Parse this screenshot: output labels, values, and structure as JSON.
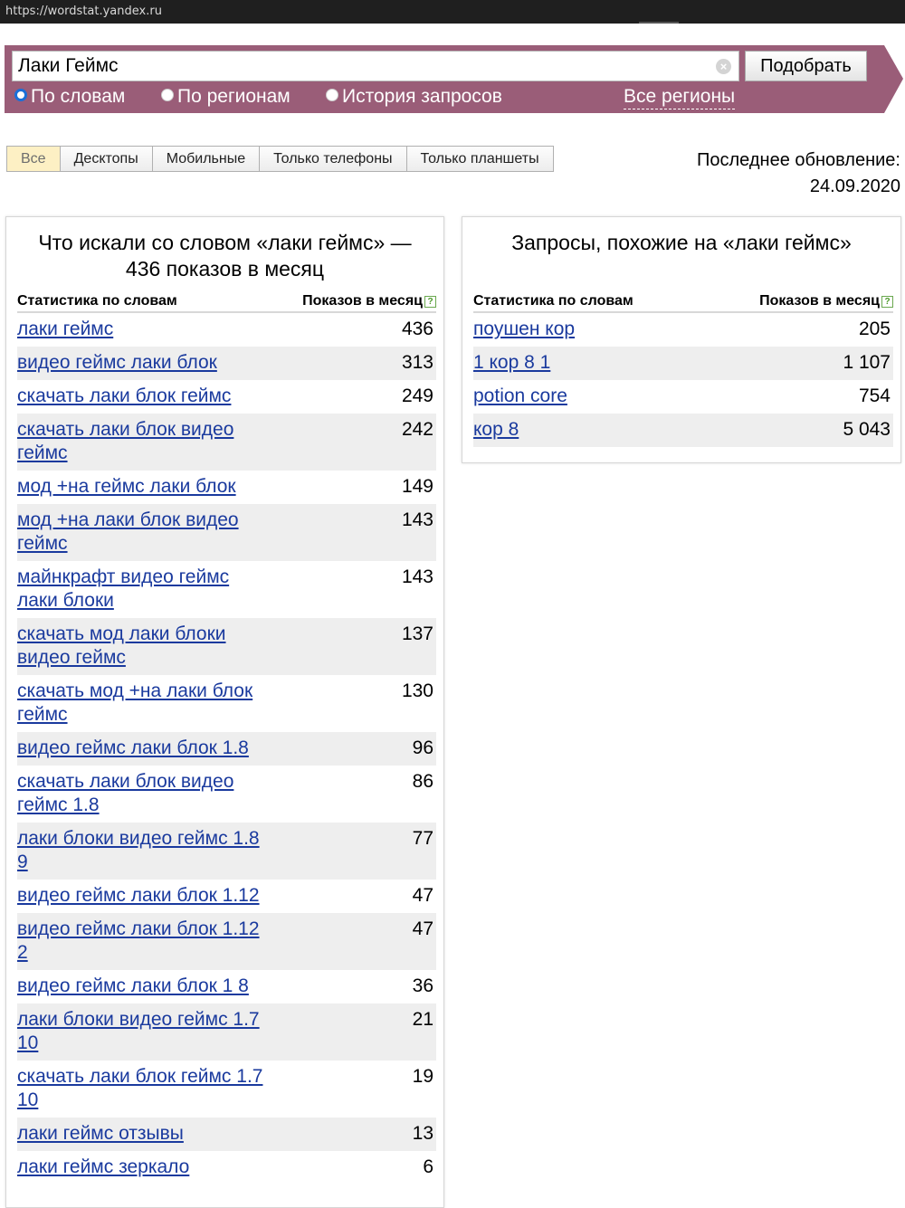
{
  "browser": {
    "url": "https://wordstat.yandex.ru"
  },
  "search": {
    "query": "Лаки Геймс",
    "submit_label": "Подобрать",
    "clear_glyph": "×",
    "modes": [
      {
        "label": "По словам",
        "selected": true
      },
      {
        "label": "По регионам",
        "selected": false
      },
      {
        "label": "История запросов",
        "selected": false
      }
    ],
    "regions_label": "Все регионы",
    "panel_color": "#9a5d78"
  },
  "tabs": [
    {
      "label": "Все",
      "active": true
    },
    {
      "label": "Десктопы",
      "active": false
    },
    {
      "label": "Мобильные",
      "active": false
    },
    {
      "label": "Только телефоны",
      "active": false
    },
    {
      "label": "Только планшеты",
      "active": false
    }
  ],
  "updated": {
    "label": "Последнее обновление:",
    "date": "24.09.2020"
  },
  "left": {
    "title": "Что искали со словом «лаки геймс» — 436 показов в месяц",
    "col_phrase": "Статистика по словам",
    "col_count": "Показов в месяц",
    "help_glyph": "?",
    "rows": [
      {
        "phrase": "лаки геймс",
        "count": "436"
      },
      {
        "phrase": "видео геймс лаки блок",
        "count": "313"
      },
      {
        "phrase": "скачать лаки блок геймс",
        "count": "249"
      },
      {
        "phrase": "скачать лаки блок видео геймс",
        "count": "242"
      },
      {
        "phrase": "мод +на геймс лаки блок",
        "count": "149"
      },
      {
        "phrase": "мод +на лаки блок видео геймс",
        "count": "143"
      },
      {
        "phrase": "майнкрафт видео геймс лаки блоки",
        "count": "143"
      },
      {
        "phrase": "скачать мод лаки блоки видео геймс",
        "count": "137"
      },
      {
        "phrase": "скачать мод +на лаки блок геймс",
        "count": "130"
      },
      {
        "phrase": "видео геймс лаки блок 1.8",
        "count": "96"
      },
      {
        "phrase": "скачать лаки блок видео геймс 1.8",
        "count": "86"
      },
      {
        "phrase": "лаки блоки видео геймс 1.8 9",
        "count": "77"
      },
      {
        "phrase": "видео геймс лаки блок 1.12",
        "count": "47"
      },
      {
        "phrase": "видео геймс лаки блок 1.12 2",
        "count": "47"
      },
      {
        "phrase": "видео геймс лаки блок 1 8",
        "count": "36"
      },
      {
        "phrase": "лаки блоки видео геймс 1.7 10",
        "count": "21"
      },
      {
        "phrase": "скачать лаки блок геймс 1.7 10",
        "count": "19"
      },
      {
        "phrase": "лаки геймс отзывы",
        "count": "13"
      },
      {
        "phrase": "лаки геймс зеркало",
        "count": "6"
      }
    ]
  },
  "right": {
    "title": "Запросы, похожие на «лаки геймс»",
    "col_phrase": "Статистика по словам",
    "col_count": "Показов в месяц",
    "help_glyph": "?",
    "rows": [
      {
        "phrase": "поушен кор",
        "count": "205"
      },
      {
        "phrase": "1 кор 8 1",
        "count": "1 107"
      },
      {
        "phrase": "potion core",
        "count": "754"
      },
      {
        "phrase": "кор 8",
        "count": "5 043"
      }
    ]
  }
}
